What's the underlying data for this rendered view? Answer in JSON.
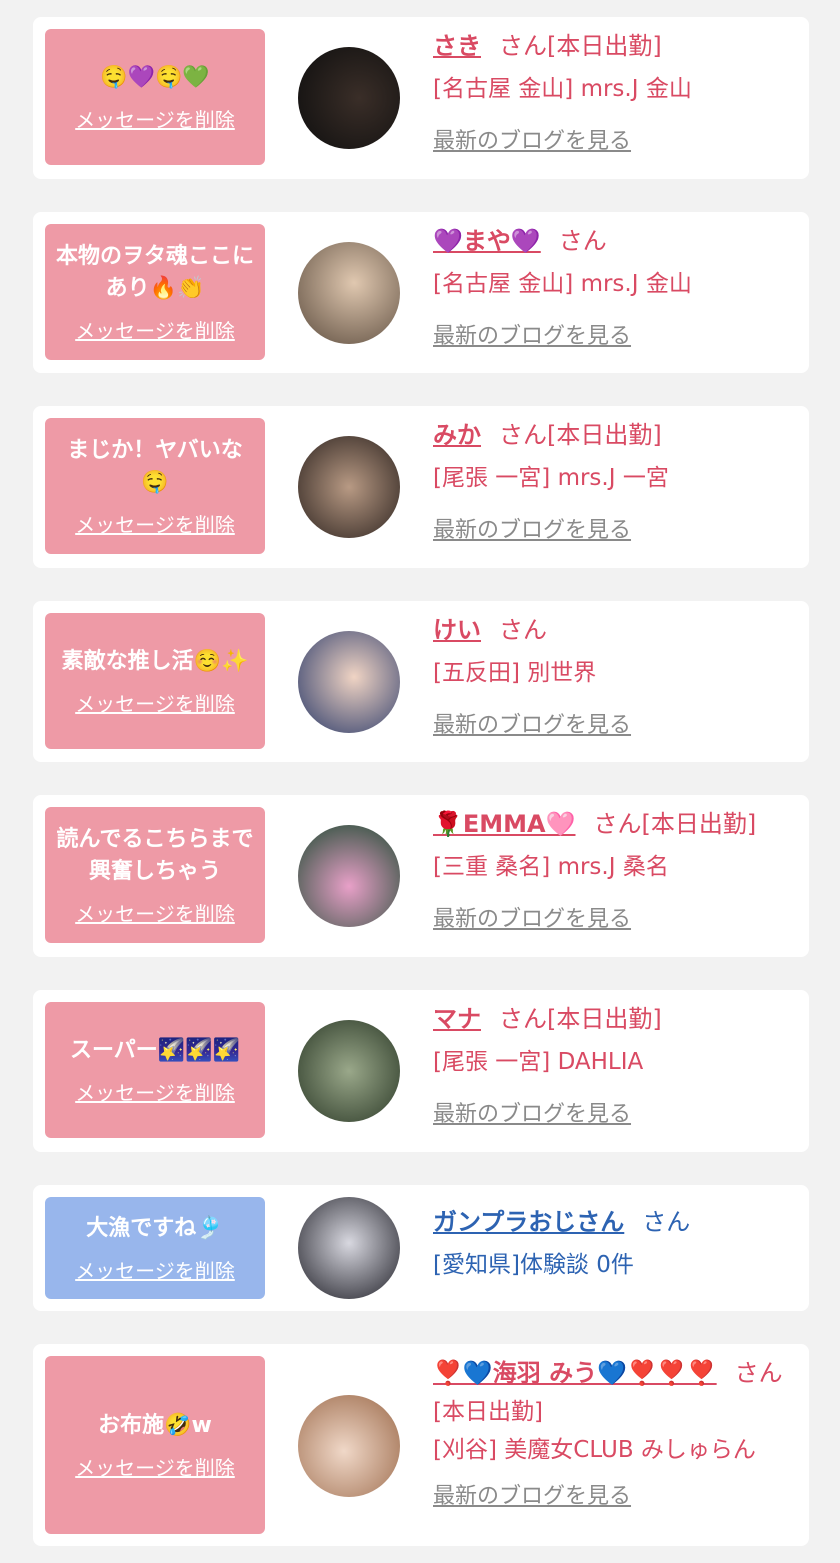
{
  "delete_label": "メッセージを削除",
  "blog_label": "最新のブログを見る",
  "san_label": "さん",
  "colors": {
    "card_pink": "#ee9aa6",
    "card_blue": "#98b6ec",
    "name_pink": "#d94a63",
    "name_blue": "#2d63b2",
    "link_gray": "#8a8a8a",
    "background": "#f2f2f2"
  },
  "items": [
    {
      "message": "🤤💜🤤💚",
      "name": "さき",
      "suffix": "[本日出勤]",
      "shop": "[名古屋 金山] mrs.J 金山",
      "extra": "",
      "show_blog": true,
      "theme": "pink",
      "avatar_colors": [
        "#1a1a1a",
        "#3a2e28"
      ]
    },
    {
      "message": "本物のヲタ魂ここにあり🔥👏",
      "name": "💜まや💜",
      "suffix": "",
      "shop": "[名古屋 金山] mrs.J 金山",
      "extra": "",
      "show_blog": true,
      "theme": "pink",
      "avatar_colors": [
        "#c9b39a",
        "#6b5a4a"
      ]
    },
    {
      "message": "まじか！ヤバいな🤤",
      "name": "みか",
      "suffix": "[本日出勤]",
      "shop": "[尾張 一宮] mrs.J 一宮",
      "extra": "",
      "show_blog": true,
      "theme": "pink",
      "avatar_colors": [
        "#4a3a32",
        "#b89a84"
      ]
    },
    {
      "message": "素敵な推し活☺️✨",
      "name": "けい",
      "suffix": "",
      "shop": "[五反田] 別世界",
      "extra": "",
      "show_blog": true,
      "theme": "pink",
      "avatar_colors": [
        "#3a4a78",
        "#e6c8b8"
      ]
    },
    {
      "message": "読んでるこちらまで興奮しちゃう",
      "name": "🌹EMMA🩷",
      "suffix": "[本日出勤]",
      "shop": "[三重 桑名] mrs.J 桑名",
      "extra": "",
      "show_blog": true,
      "theme": "pink",
      "avatar_colors": [
        "#1f5a3a",
        "#e8a0c8"
      ]
    },
    {
      "message": "スーパー🌠🌠🌠",
      "name": "マナ",
      "suffix": "[本日出勤]",
      "shop": "[尾張 一宮] DAHLIA",
      "extra": "",
      "show_blog": true,
      "theme": "pink",
      "avatar_colors": [
        "#3c4a36",
        "#9aa88a"
      ]
    },
    {
      "message": "大漁ですね🎐",
      "name": "ガンプラおじさん",
      "suffix": "",
      "shop": "[愛知県]体験談 0件",
      "extra": "",
      "show_blog": false,
      "theme": "blue",
      "avatar_colors": [
        "#2a2a30",
        "#c8c8d0"
      ]
    },
    {
      "message": "お布施🤣w",
      "name": "❣️💙海羽 みう💙❣️❣️❣️",
      "suffix": "",
      "shop": "[本日出勤]",
      "extra": "[刈谷] 美魔女CLUB みしゅらん",
      "show_blog": true,
      "theme": "pink",
      "avatar_colors": [
        "#c89878",
        "#f0d8c8"
      ]
    }
  ]
}
